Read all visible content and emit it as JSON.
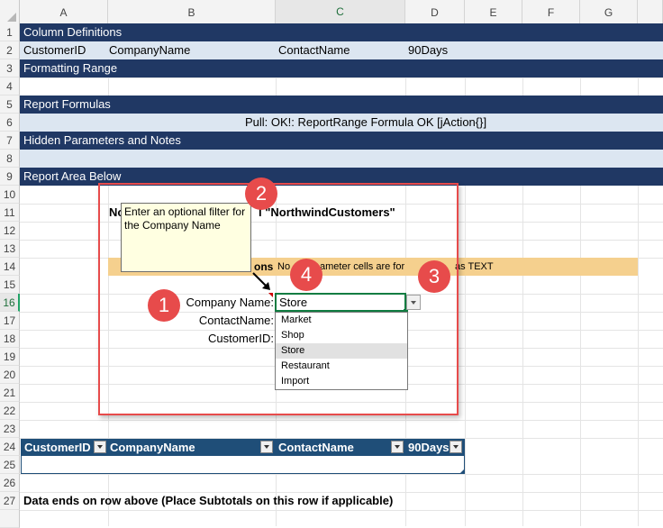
{
  "columns": [
    "A",
    "B",
    "C",
    "D",
    "E",
    "F",
    "G"
  ],
  "rows": [
    "1",
    "2",
    "3",
    "4",
    "5",
    "6",
    "7",
    "8",
    "9",
    "10",
    "11",
    "12",
    "13",
    "14",
    "15",
    "16",
    "17",
    "18",
    "19",
    "20",
    "21",
    "22",
    "23",
    "24",
    "25",
    "26",
    "27"
  ],
  "sheet": {
    "row1": "Column Definitions",
    "row2": [
      "CustomerID",
      "CompanyName",
      "ContactName",
      "90Days"
    ],
    "row3": "Formatting Range",
    "row5": "Report Formulas",
    "row6": "Pull:  OK!: ReportRange Formula OK [jAction{}]",
    "row7": "Hidden Parameters and Notes",
    "row9": "Report Area Below",
    "row11_left": "No",
    "row11_right": "l \"NorthwindCustomers\"",
    "row14_left": "ons",
    "row14_mid": "No",
    "row14_right": "ameter cells are for",
    "row14_end": "as TEXT",
    "label_company": "Company Name:",
    "label_contact": "ContactName:",
    "label_customer": "CustomerID:",
    "company_value": "Store",
    "row27": "Data ends on row above (Place Subtotals on this row if applicable)"
  },
  "tooltip": "Enter an optional filter for the Company Name",
  "dropdown_options": [
    "Market",
    "Shop",
    "Store",
    "Restaurant",
    "Import"
  ],
  "dropdown_selected": "Store",
  "table_headers": [
    "CustomerID",
    "CompanyName",
    "ContactName",
    "90Days"
  ],
  "badges": [
    "1",
    "2",
    "3",
    "4"
  ],
  "colors": {
    "dark_band": "#203864",
    "light_band": "#dce6f1",
    "note_band": "#f5d08e",
    "table_header": "#1f4e78",
    "annotation": "#e74b4b"
  }
}
